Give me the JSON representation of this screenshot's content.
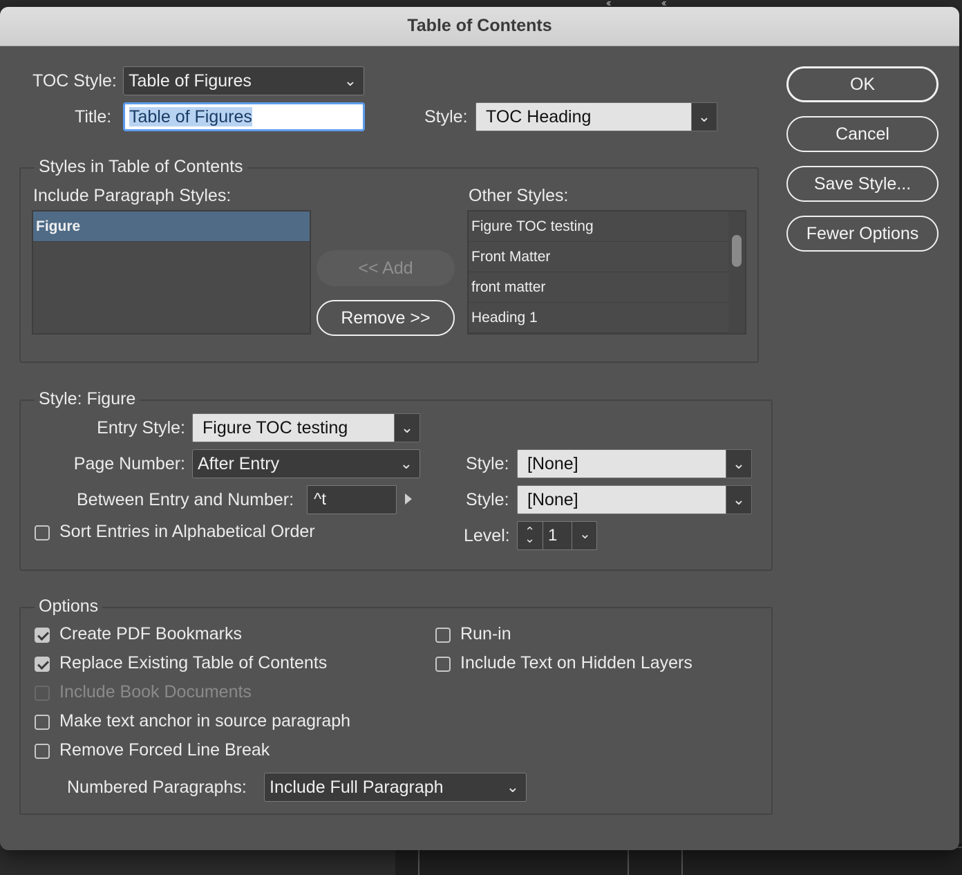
{
  "window": {
    "title": "Table of Contents"
  },
  "toc_style": {
    "label": "TOC Style:",
    "value": "Table of Figures"
  },
  "title_field": {
    "label": "Title:",
    "value": "Table of Figures"
  },
  "title_style": {
    "label": "Style:",
    "value": "TOC Heading"
  },
  "buttons": {
    "ok": "OK",
    "cancel": "Cancel",
    "save_style": "Save Style...",
    "fewer_options": "Fewer Options",
    "add": "<< Add",
    "remove": "Remove >>"
  },
  "styles_group": {
    "title": "Styles in Table of Contents",
    "include_label": "Include Paragraph Styles:",
    "include_items": [
      "Figure"
    ],
    "other_label": "Other Styles:",
    "other_items": [
      "Figure TOC testing",
      "Front Matter",
      "front matter",
      "Heading 1"
    ]
  },
  "style_figure": {
    "title": "Style: Figure",
    "entry_style_label": "Entry Style:",
    "entry_style_value": "Figure TOC testing",
    "page_number_label": "Page Number:",
    "page_number_value": "After Entry",
    "page_number_style_label": "Style:",
    "page_number_style_value": "[None]",
    "between_label": "Between Entry and Number:",
    "between_value": "^t",
    "between_style_label": "Style:",
    "between_style_value": "[None]",
    "sort_label": "Sort Entries in Alphabetical Order",
    "sort_checked": false,
    "level_label": "Level:",
    "level_value": "1"
  },
  "options": {
    "title": "Options",
    "create_pdf_bookmarks": {
      "label": "Create PDF Bookmarks",
      "checked": true
    },
    "replace_existing": {
      "label": "Replace Existing Table of Contents",
      "checked": true
    },
    "include_book_docs": {
      "label": "Include Book Documents",
      "checked": false,
      "disabled": true
    },
    "make_text_anchor": {
      "label": "Make text anchor in source paragraph",
      "checked": false
    },
    "remove_forced_line_break": {
      "label": "Remove Forced Line Break",
      "checked": false
    },
    "run_in": {
      "label": "Run-in",
      "checked": false
    },
    "include_hidden_layers": {
      "label": "Include Text on Hidden Layers",
      "checked": false
    },
    "numbered_paragraphs_label": "Numbered Paragraphs:",
    "numbered_paragraphs_value": "Include Full Paragraph"
  },
  "icons": [
    "chevron-down-icon",
    "chevron-up-icon",
    "play-triangle-icon",
    "checkmark-icon"
  ],
  "colors": {
    "dialog_bg": "#535353",
    "selection": "#4f6b86",
    "focus_ring": "#5d9cec"
  }
}
